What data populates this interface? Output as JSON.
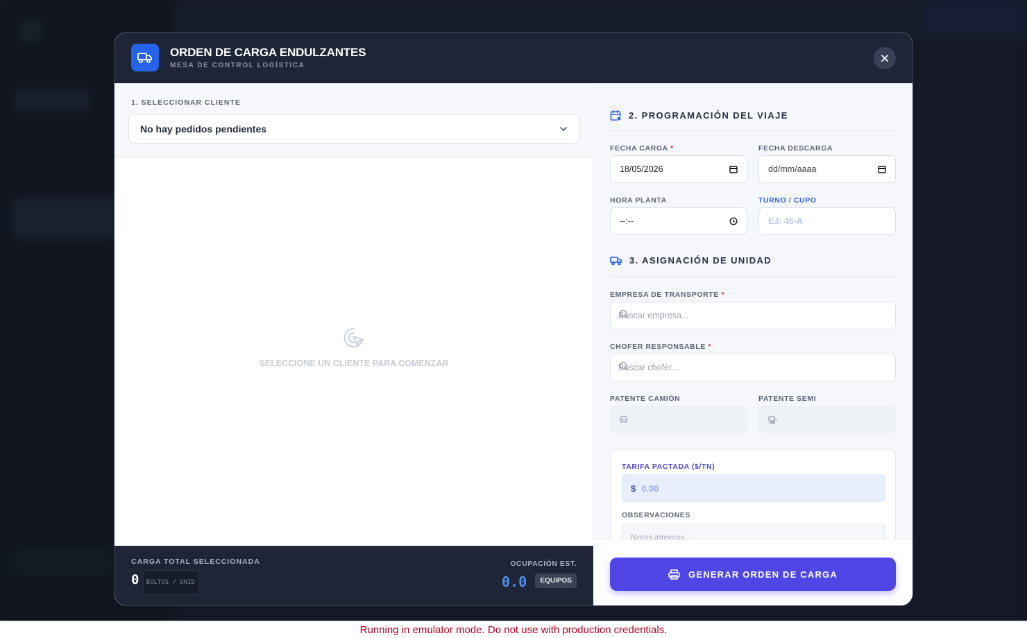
{
  "modal": {
    "title": "ORDEN DE CARGA ENDULZANTES",
    "subtitle": "MESA DE CONTROL LOGÍSTICA"
  },
  "client": {
    "label": "1. SELECCIONAR CLIENTE",
    "selected": "No hay pedidos pendientes"
  },
  "empty_state": {
    "text": "SELECCIONE UN CLIENTE PARA COMENZAR"
  },
  "summary": {
    "total_label": "CARGA TOTAL SELECCIONADA",
    "total_count": "0",
    "total_unit": "BULTOS / UNID",
    "occupancy_label": "OCUPACIÓN EST.",
    "occupancy_value": "0.0",
    "occupancy_unit": "EQUIPOS"
  },
  "trip": {
    "section_title": "2. PROGRAMACIÓN DEL VIAJE",
    "fecha_carga_label": "FECHA CARGA",
    "fecha_carga_value": "18/05/2026",
    "fecha_descarga_label": "FECHA DESCARGA",
    "fecha_descarga_placeholder": "dd/mm/aaaa",
    "hora_planta_label": "HORA PLANTA",
    "hora_planta_placeholder": "--:--",
    "turno_label": "TURNO / CUPO",
    "turno_placeholder": "EJ: 45-A"
  },
  "unit": {
    "section_title": "3. ASIGNACIÓN DE UNIDAD",
    "empresa_label": "EMPRESA DE TRANSPORTE",
    "empresa_placeholder": "Buscar empresa...",
    "chofer_label": "CHOFER RESPONSABLE",
    "chofer_placeholder": "Buscar chofer...",
    "patente_camion_label": "PATENTE CAMIÓN",
    "patente_semi_label": "PATENTE SEMI",
    "required_mark": "*"
  },
  "tarifa": {
    "label": "TARIFA PACTADA ($/TN)",
    "currency": "$",
    "placeholder": "0.00",
    "obs_label": "OBSERVACIONES",
    "obs_placeholder": "Notas internas..."
  },
  "actions": {
    "generate_label": "GENERAR ORDEN DE CARGA"
  },
  "footer_notice": "Running in emulator mode. Do not use with production credentials.",
  "colors": {
    "primary": "#4f46e5",
    "header_bg": "#1e2536",
    "accent_blue": "#2563eb",
    "required": "#e0323c"
  }
}
